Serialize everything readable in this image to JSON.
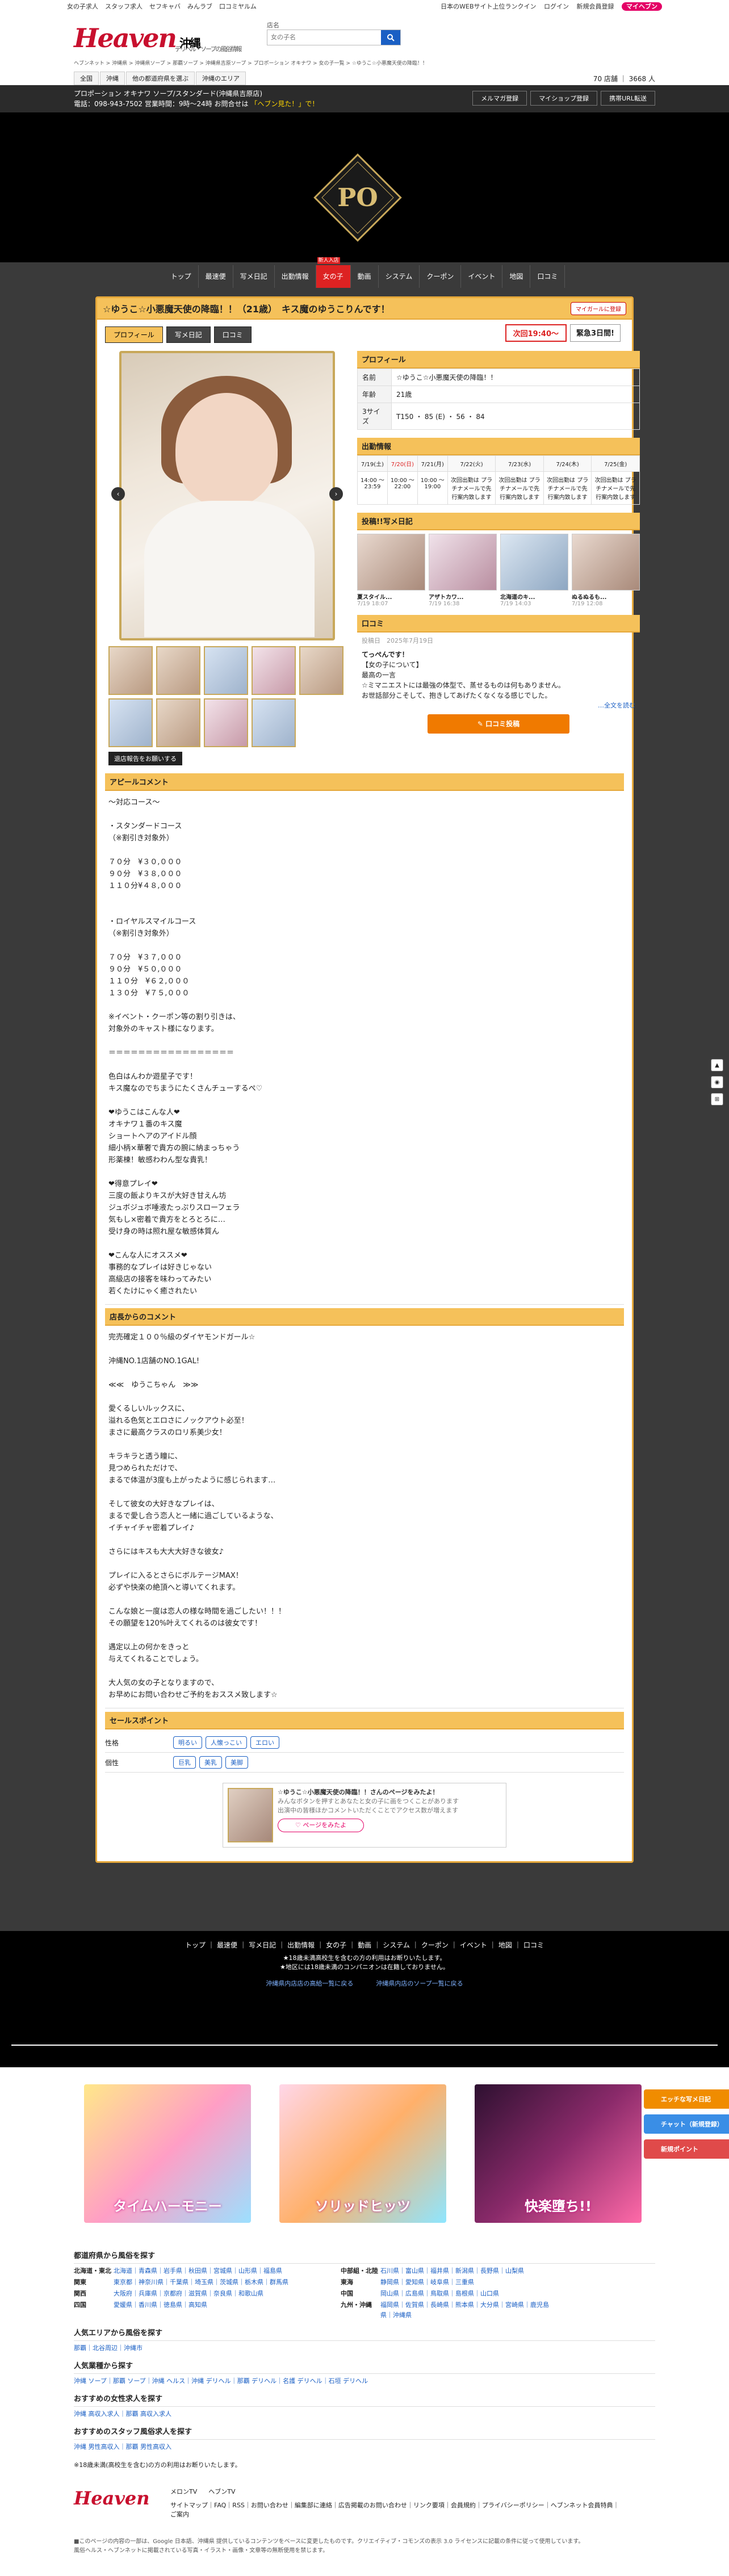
{
  "topstrip": {
    "left": [
      "女の子求人",
      "スタッフ求人",
      "セフキャバ",
      "みんラブ",
      "口コミヤルム"
    ],
    "right": {
      "rank": "日本のWEBサイト上位ランクイン",
      "login": "ログイン",
      "register": "新規会員登録",
      "myheaven": "マイヘブン"
    }
  },
  "header": {
    "logo": "Heaven",
    "region": "沖縄",
    "subtitle": "デリヘル・ソープの風俗情報",
    "search_label": "店名",
    "search_placeholder": "女の子名",
    "nav": [
      "全国",
      "沖縄",
      "他の都道府県を選ぶ",
      "沖縄のエリア"
    ],
    "breadcrumb": "ヘブンネット > 沖縄県 > 沖縄県ソープ > 那覇ソープ > 沖縄県吉原ソープ > プロポーション オキナワ > 女の子一覧 > ☆ゆうこ☆小悪魔天使の降臨！！"
  },
  "shop": {
    "name": "プロポーション オキナワ ソープ/スタンダード(沖縄県吉原店)",
    "tel": "電話：098-943-7502 営業時間：9時〜24時 お問合せは",
    "em": "「ヘブン見た！」で！",
    "buttons": [
      "メルマガ登録",
      "マイショップ登録",
      "携帯URL転送"
    ],
    "count": "70 店舗 ｜ 3668 人"
  },
  "emblem": "PO",
  "shopnav": [
    "トップ",
    "最速便",
    "写メ日記",
    "出勤情報",
    "女の子",
    "動画",
    "システム",
    "クーポン",
    "イベント",
    "地図",
    "口コミ"
  ],
  "shopnav_badge": "新人入店",
  "girl": {
    "title": "☆ゆうこ☆小悪魔天使の降臨！！（21歳）　キス魔のゆうこりんです！",
    "fav": "マイガールに登録",
    "tabs": [
      "プロフィール",
      "写メ日記",
      "口コミ"
    ],
    "next": "次回19:40〜",
    "quick": "緊急3日間!"
  },
  "profile": {
    "head": "プロフィール",
    "rows": [
      {
        "k": "名前",
        "v": "☆ゆうこ☆小悪魔天使の降臨！！"
      },
      {
        "k": "年齢",
        "v": "21歳"
      },
      {
        "k": "3サイズ",
        "v": "T150 ・ 85 (E) ・ 56 ・ 84"
      }
    ]
  },
  "schedule": {
    "head": "出勤情報",
    "days": [
      "7/19(土)",
      "7/20(日)",
      "7/21(月)",
      "7/22(火)",
      "7/23(水)",
      "7/24(木)",
      "7/25(金)"
    ],
    "times": [
      "14:00 〜 23:59",
      "10:00 〜 22:00",
      "10:00 〜 19:00",
      "次回出勤は プラチナメールで先行案内致します",
      "次回出勤は プラチナメールで先行案内致します",
      "次回出勤は プラチナメールで先行案内致します",
      "次回出勤は プラチナメールで先行案内致します"
    ]
  },
  "diary": {
    "head": "投稿!!写メ日記",
    "items": [
      {
        "cap": "夏スタイル...",
        "dt": "7/19 18:07"
      },
      {
        "cap": "アザトカワ...",
        "dt": "7/19 16:38"
      },
      {
        "cap": "北海道のキ...",
        "dt": "7/19 14:03"
      },
      {
        "cap": "ぬるぬるも...",
        "dt": "7/19 12:08"
      }
    ]
  },
  "review": {
    "head": "口コミ",
    "date": "投稿日　2025年7月19日",
    "title": "てっぺんです！",
    "body": "【女の子について】\n最高の一言\n☆ミマニエストには最強の体型で、蒸せるものは何もありません。\nお世話部分こそして、抱きしてあげたくなくなる感じでした。",
    "more": "…全文を読む",
    "btn": "口コミ投稿"
  },
  "recbtn": "退店報告をお願いする",
  "appeal": {
    "head": "アピールコメント",
    "body": "〜対応コース〜\n\n・スタンダードコース\n（※割引き対象外）\n\n７０分　¥３０,０００\n９０分　¥３８,０００\n１１０分¥４８,０００\n\n\n・ロイヤルスマイルコース\n（※割引き対象外）\n\n７０分　¥３７,０００\n９０分　¥５０,０００\n１１０分　¥６２,０００\n１３０分　¥７５,０００\n\n※イベント・クーポン等の割り引きは、\n対象外のキャスト様になります。\n\n＝＝＝＝＝＝＝＝＝＝＝＝＝＝＝＝＝\n\n色白はんわか遊星子です！\nキス魔なのでちまうにたくさんチューするぺ♡\n\n❤ゆうこはこんな人❤\nオキナワ１番のキス魔\nショートヘアのアイドル顔\n細小柄×華奢で貴方の腕に納まっちゃう\n形薬棟！敏感わわん型な貴乳！\n\n❤得意プレイ❤\n三度の飯よりキスが大好き甘えん坊\nジュボジュボ唾液たっぷりスローフェラ\n気もし×密着で貴方をとろとろに…\n受け身の時は照れ屋な敏感体質ん\n\n❤こんな人にオススメ❤\n事務的なプレイは好きじゃない\n高級店の接客を味わってみたい\n若くたけにゃく癒されたい"
  },
  "staff": {
    "head": "店長からのコメント",
    "body": "完売確定１００％級のダイヤモンドガール☆\n\n沖縄NO.1店舗のNO.1GAL!\n\n≪≪　ゆうこちゃん　≫≫\n\n愛くるしいルックスに、\n溢れる色気とエロさにノックアウト必至！\nまさに最高クラスのロリ系美少女！\n\nキラキラと透う瞳に、\n見つめられただけで、\nまるで体温が3度も上がったように感じられます…\n\nそして彼女の大好きなプレイは、\nまるで愛し合う恋人と一緒に過ごしているような、\nイチャイチャ密着プレイ♪\n\nさらにはキスも大大大好きな彼女♪\n\nプレイに入るとさらにボルテージMAX！\n必ずや快楽の絶頂へと導いてくれます。\n\nこんな娘と一度は恋人の様な時間を過ごしたい！！！\nその願望を120%叶えてくれるのは彼女です！\n\n遇定以上の何かをきっと\n与えてくれることでしょう。\n\n大人気の女の子となりますので、\nお早めにお問い合わせご予約をおススメ致します☆"
  },
  "points": {
    "head": "セールスポイント",
    "rows": [
      {
        "k": "性格",
        "tags": [
          "明るい",
          "人懐っこい",
          "エロい"
        ]
      },
      {
        "k": "個性",
        "tags": [
          "巨乳",
          "美乳",
          "美脚"
        ]
      }
    ]
  },
  "share": {
    "text": "☆ゆうこ☆小悪魔天使の降臨！！さんのページをみたよ！",
    "sub": "みんなボタンを押すとあなたと女の子に画をつくことがあります\n出演中の皆様ほかコメントいただくことでアクセス数が増えます",
    "btn": "ページをみたよ"
  },
  "footnav": {
    "links": [
      "トップ",
      "最速便",
      "写メ日記",
      "出勤情報",
      "女の子",
      "動画",
      "システム",
      "クーポン",
      "イベント",
      "地図",
      "口コミ"
    ],
    "notes": "★18歳未満高校生を含むの方の利用はお断りいたします。\n★地区には18歳未満のコンパニオンは在籍しておりません。",
    "blinks": [
      "沖縄県内店店の高給一覧に戻る",
      "沖縄県内店のソープ一覧に戻る"
    ]
  },
  "banners": [
    "タイムハーモニー",
    "ソリッドヒッツ",
    "快楽墮ち!!"
  ],
  "float": [
    "エッチな写メ日記",
    "チャット（新規登録）",
    "新規ポイント"
  ],
  "sidebtns": [
    "▲",
    "◉",
    "⊞"
  ],
  "linksec": {
    "h1": "都道府県から風俗を探す",
    "areas": [
      {
        "k": "北海道・東北",
        "v": "北海道｜青森県｜岩手県｜秋田県｜宮城県｜山形県｜福島県",
        "k2": "中部組・北陸",
        "v2": "石川県｜富山県｜福井県｜新潟県｜長野県｜山梨県"
      },
      {
        "k": "関東",
        "v": "東京都｜神奈川県｜千葉県｜埼玉県｜茨城県｜栃木県｜群馬県",
        "k2": "東海",
        "v2": "静岡県｜愛知県｜岐阜県｜三重県"
      },
      {
        "k": "関西",
        "v": "大阪府｜兵庫県｜京都府｜滋賀県｜奈良県｜和歌山県",
        "k2": "中国",
        "v2": "岡山県｜広島県｜鳥取県｜島根県｜山口県"
      },
      {
        "k": "四国",
        "v": "愛媛県｜香川県｜徳島県｜高知県",
        "k2": "九州・沖縄",
        "v2": "福岡県｜佐賀県｜長崎県｜熊本県｜大分県｜宮崎県｜鹿児島県｜沖縄県"
      }
    ],
    "h2": "人気エリアから風俗を探す",
    "t2": "那覇｜北谷周辺｜沖縄市",
    "h3": "人気業種から探す",
    "t3": "沖縄 ソープ｜那覇 ソープ｜沖縄 ヘルス｜沖縄 デリヘル｜那覇 デリヘル｜名護 デリヘル｜石垣 デリヘル",
    "h4": "おすすめの女性求人を探す",
    "t4": "沖縄 高収入求人｜那覇 高収入求人",
    "h5": "おすすめのスタッフ風俗求人を探す",
    "t5": "沖縄 男性高収入｜那覇 男性高収入",
    "t6": "※18歳未満(高校生を含む)の方の利用はお断りいたします。"
  },
  "footer": {
    "logo": "Heaven",
    "apps": [
      "メロンTV",
      "ヘブンTV"
    ],
    "links": "サイトマップ｜FAQ｜RSS｜お問い合わせ｜編集部に連絡｜広告掲載のお問い合わせ｜リンク要項｜会員規約｜プライバシーポリシー｜ヘブンネット会員特典｜ご案内",
    "copy": "■このページの内容の一部は、Google 日本語、沖縄県 提供しているコンテンツをベースに変更したものです。クリエイティブ・コモンズの表示 3.0 ライセンスに記載の条件に従って使用しています。\n風俗ヘルス・ヘブンネットに掲載されている写真・イラスト・画像・文章等の無断使用を禁じます。"
  }
}
